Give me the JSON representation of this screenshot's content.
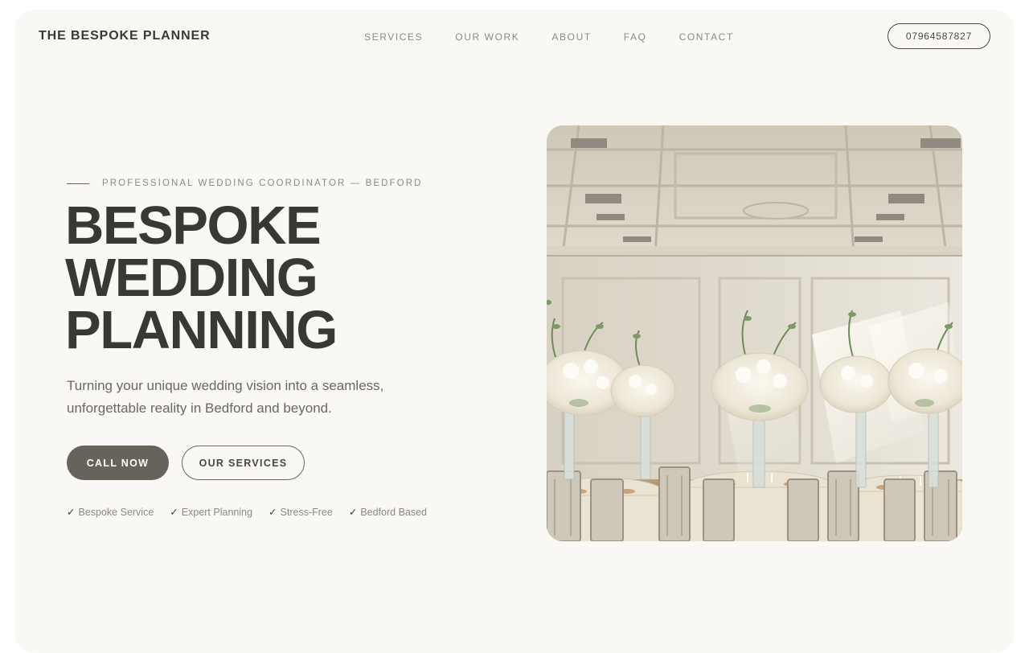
{
  "brand": {
    "name": "THE BESPOKE PLANNER"
  },
  "nav": {
    "items": [
      {
        "label": "SERVICES"
      },
      {
        "label": "OUR WORK"
      },
      {
        "label": "ABOUT"
      },
      {
        "label": "FAQ"
      },
      {
        "label": "CONTACT"
      }
    ]
  },
  "header": {
    "phone": "07964587827"
  },
  "hero": {
    "eyebrow": "PROFESSIONAL WEDDING COORDINATOR — BEDFORD",
    "headline": [
      "BESPOKE",
      "WEDDING",
      "PLANNING"
    ],
    "lede": "Turning your unique wedding vision into a seamless, unforgettable reality in Bedford and beyond.",
    "cta_primary": "CALL NOW",
    "cta_secondary": "OUR SERVICES",
    "features": [
      {
        "check": "✓",
        "label": "Bespoke Service"
      },
      {
        "check": "✓",
        "label": "Expert Planning"
      },
      {
        "check": "✓",
        "label": "Stress-Free"
      },
      {
        "check": "✓",
        "label": "Bedford Based"
      }
    ]
  },
  "colors": {
    "background": "#f9f8f5",
    "text": "#3a3834",
    "muted": "#8c8983",
    "primary_button": "#67625a"
  },
  "icons": {
    "feature_check": "check-icon"
  }
}
